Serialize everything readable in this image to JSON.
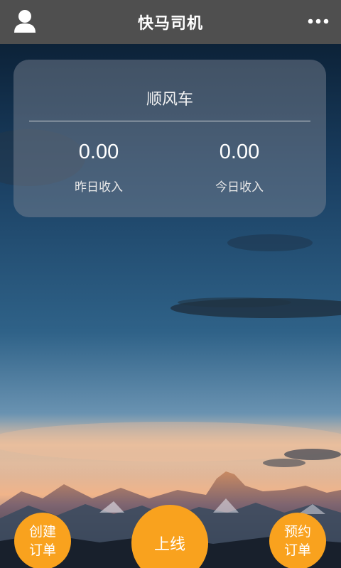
{
  "header": {
    "title": "快马司机",
    "left_icon": "user-profile-icon",
    "right_icon": "more-dots-icon"
  },
  "card": {
    "title": "顺风车",
    "yesterday": {
      "value": "0.00",
      "label": "昨日收入"
    },
    "today": {
      "value": "0.00",
      "label": "今日收入"
    }
  },
  "actions": {
    "create_order": "创建订单",
    "go_online": "上线",
    "reserve_order": "预约订单"
  },
  "colors": {
    "header_bg": "#4f4f4f",
    "accent_orange": "#f9a21e",
    "card_overlay": "rgba(130,138,150,0.45)"
  }
}
